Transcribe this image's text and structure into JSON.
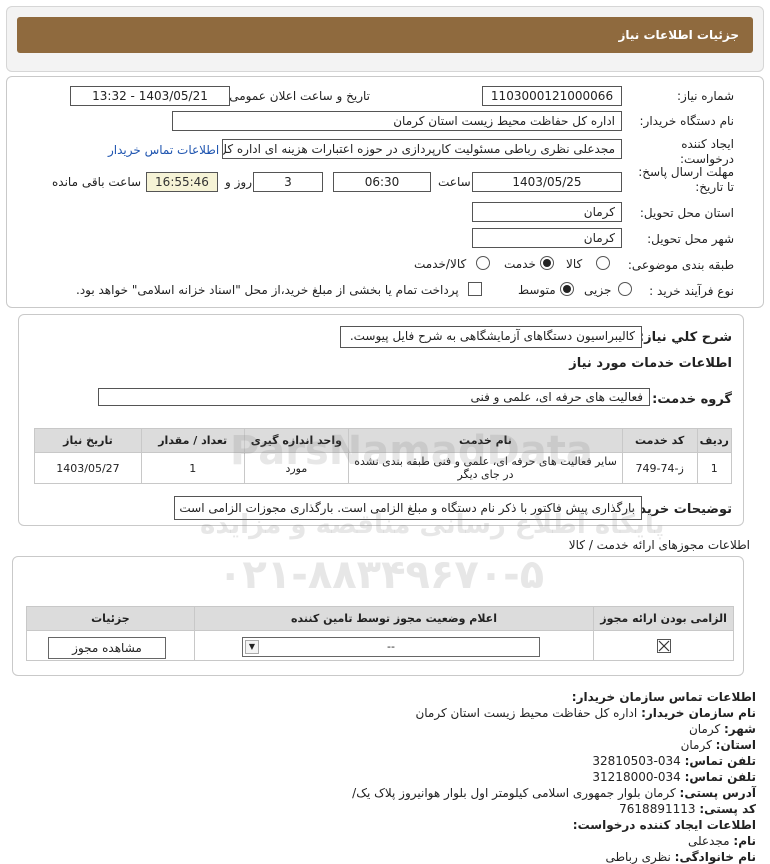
{
  "header": {
    "title": "جزئیات اطلاعات نیاز"
  },
  "need": {
    "need_number_label": "شماره نیاز:",
    "need_number": "1103000121000066",
    "announce_label": "تاریخ و ساعت اعلان عمومی:",
    "announce_value": "1403/05/21 - 13:32",
    "buyer_name_label": "نام دستگاه خریدار:",
    "buyer_name": "اداره کل حفاظت محیط زیست استان کرمان",
    "creator_label": "ایجاد کننده درخواست:",
    "creator_value": "مجدعلی نظری رباطی مسئولیت کارپردازی در حوزه اعتبارات هزینه ای اداره کل ح",
    "contact_link": "اطلاعات تماس خریدار",
    "deadline_label": "مهلت ارسال پاسخ: تا تاریخ:",
    "deadline_date": "1403/05/25",
    "time_label": "ساعت",
    "deadline_time": "06:30",
    "days_value": "3",
    "days_label": "روز و",
    "remaining_time": "16:55:46",
    "remaining_label": "ساعت باقی مانده",
    "province_label": "استان محل تحویل:",
    "province": "کرمان",
    "city_label": "شهر محل تحویل:",
    "city": "کرمان",
    "category_label": "طبقه بندی موضوعی:",
    "category_options": [
      "کالا",
      "خدمت",
      "کالا/خدمت"
    ],
    "category_selected": "خدمت",
    "process_label": "نوع فرآیند خرید :",
    "process_options": [
      "جزیی",
      "متوسط"
    ],
    "process_selected": "متوسط",
    "treasury_note": "پرداخت تمام یا بخشی از مبلغ خرید،از محل \"اسناد خزانه اسلامی\" خواهد بود."
  },
  "summary": {
    "label": "شرح کلي نياز:",
    "value": "کالیبراسیون دستگاهای آزمایشگاهی به شرح فایل پیوست.",
    "services_title": "اطلاعات خدمات مورد نياز",
    "group_label": "گروه خدمت:",
    "group_value": "فعالیت های حرفه ای، علمی و فنی",
    "table_headers": [
      "ردیف",
      "کد خدمت",
      "نام خدمت",
      "واحد اندازه گیری",
      "تعداد / مقدار",
      "تاریخ نیاز"
    ],
    "rows": [
      {
        "idx": "1",
        "code": "ز-74-749",
        "name": "سایر فعالیت های حرفه ای، علمی و فنی طبقه بندی نشده در جای دیگر",
        "unit": "مورد",
        "qty": "1",
        "date": "1403/05/27"
      }
    ],
    "buyer_notes_label": "توضیحات خریدار:",
    "buyer_notes": "بارگذاری پیش فاکتور با ذکر نام دستگاه و مبلغ الزامی است. بارگذاری مجوزات الزامی است"
  },
  "permits": {
    "section_label": "اطلاعات مجوزهای ارائه خدمت / کالا",
    "headers": [
      "الزامی بودن ارائه مجوز",
      "اعلام وضعیت مجوز توسط تامین کننده",
      "جزئیات"
    ],
    "select_value": "--",
    "view_button": "مشاهده مجوز"
  },
  "contact": {
    "title": "اطلاعات تماس سازمان خریدار:",
    "org_label": "نام سازمان خریدار:",
    "org_value": "اداره کل حفاظت محیط زیست استان کرمان",
    "city_label": "شهر:",
    "city_value": "کرمان",
    "province_label": "استان:",
    "province_value": "کرمان",
    "phone_label": "تلفن تماس:",
    "phone_value": "034-32810503",
    "fax_label": "تلفن تماس:",
    "fax_value": "034-31218000",
    "address_label": "آدرس پستی:",
    "address_value": "کرمان بلوار جمهوری اسلامی کیلومتر اول بلوار هوانیروز پلاک یک/",
    "postal_label": "کد پستی:",
    "postal_value": "7618891113",
    "creator_title": "اطلاعات ایجاد کننده درخواست:",
    "first_name_label": "نام:",
    "first_name_value": "مجدعلی",
    "last_name_label": "نام خانوادگی:",
    "last_name_value": "نظری رباطی"
  },
  "watermark": {
    "brand": "ParsNamadData",
    "portal": "پایگاه اطلاع رسانی مناقصه و مزایده",
    "phone": "۰۲۱-۸۸۳۴۹۶۷۰-۵"
  }
}
